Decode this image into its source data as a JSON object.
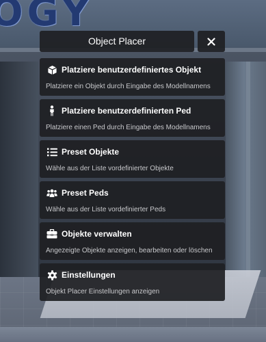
{
  "background": {
    "sign_text": "OGY"
  },
  "header": {
    "title": "Object Placer",
    "close_icon": "close-icon"
  },
  "menu": {
    "items": [
      {
        "icon": "cube-icon",
        "title": "Platziere benutzerdefiniertes Objekt",
        "description": "Platziere ein Objekt durch Eingabe des Modellnamens"
      },
      {
        "icon": "person-icon",
        "title": "Platziere benutzerdefinierten Ped",
        "description": "Platziere einen Ped durch Eingabe des Modellnamens"
      },
      {
        "icon": "list-icon",
        "title": "Preset Objekte",
        "description": "Wähle aus der Liste vordefinierter Objekte"
      },
      {
        "icon": "users-icon",
        "title": "Preset Peds",
        "description": "Wähle aus der Liste vordefinierter Peds"
      },
      {
        "icon": "toolbox-icon",
        "title": "Objekte verwalten",
        "description": "Angezeigte Objekte anzeigen, bearbeiten oder löschen"
      },
      {
        "icon": "gear-icon",
        "title": "Einstellungen",
        "description": "Objekt Placer Einstellungen anzeigen"
      }
    ]
  }
}
